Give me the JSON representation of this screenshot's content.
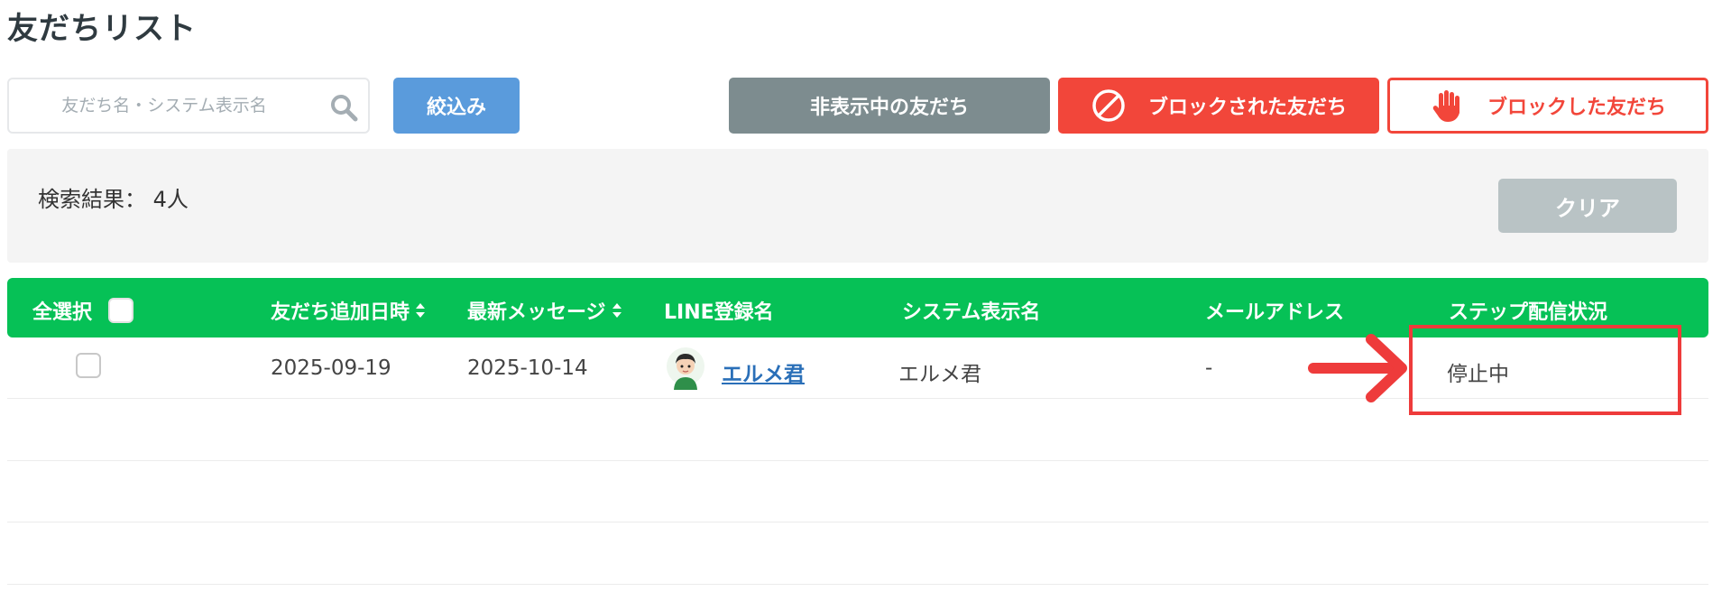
{
  "page": {
    "title": "友だちリスト"
  },
  "search": {
    "placeholder": "友だち名・システム表示名"
  },
  "toolbar": {
    "filter_label": "絞込み",
    "hidden_label": "非表示中の友だち",
    "blocked_by_label": "ブロックされた友だち",
    "blocked_label": "ブロックした友だち"
  },
  "results": {
    "text": "検索結果： 4人",
    "clear_label": "クリア"
  },
  "table": {
    "headers": {
      "select_all": "全選択",
      "added_date": "友だち追加日時",
      "latest_message": "最新メッセージ",
      "line_name": "LINE登録名",
      "system_name": "システム表示名",
      "email": "メールアドレス",
      "step_status": "ステップ配信状況"
    },
    "rows": [
      {
        "added_date": "2025-09-19",
        "latest_message": "2025-10-14",
        "line_name": "エルメ君",
        "system_name": "エルメ君",
        "email": "-",
        "step_status": "停止中"
      }
    ]
  },
  "colors": {
    "header_green": "#06c156",
    "filter_blue": "#5a9bdc",
    "hidden_gray": "#7d8c8f",
    "block_red": "#f2463a",
    "clear_gray": "#b9c3c5",
    "annotation_red": "#ee3b3b"
  },
  "icons": [
    "search-icon",
    "prohibited-icon",
    "hand-icon",
    "sort-icon",
    "avatar",
    "arrow-annotation"
  ]
}
